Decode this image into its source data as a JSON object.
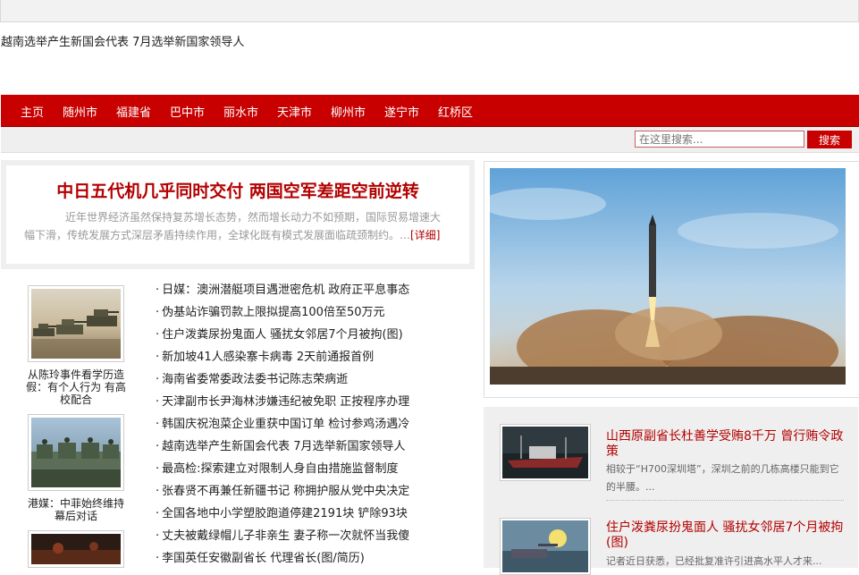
{
  "top_headline": "越南选举产生新国会代表  7月选举新国家领导人",
  "nav": {
    "items": [
      "主页",
      "随州市",
      "福建省",
      "巴中市",
      "丽水市",
      "天津市",
      "柳州市",
      "遂宁市",
      "红桥区"
    ]
  },
  "search": {
    "placeholder": "在这里搜索...",
    "button_label": "搜索"
  },
  "feature": {
    "title": "中日五代机几乎同时交付  两国空军差距空前逆转",
    "summary": "近年世界经济虽然保持复苏增长态势，然而增长动力不如预期，国际贸易增速大幅下滑，传统发展方式深层矛盾持续作用，全球化既有模式发展面临疏颈制约。…",
    "more_label": "[详细]"
  },
  "thumbs": [
    {
      "caption": "从陈玲事件看学历造假：有个人行为 有高校配合",
      "icon": "tanks-photo"
    },
    {
      "caption": "港媒：中菲始终维持幕后对话",
      "icon": "military-parade-photo"
    }
  ],
  "news_list": [
    "日媒：澳洲潜艇项目遇泄密危机 政府正平息事态",
    "伪基站诈骗罚款上限拟提高100倍至50万元",
    "住户泼粪尿扮鬼面人 骚扰女邻居7个月被拘(图)",
    "新加坡41人感染寨卡病毒 2天前通报首例",
    "海南省委常委政法委书记陈志荣病逝",
    "天津副市长尹海林涉嫌违纪被免职 正按程序办理",
    "韩国庆祝泡菜企业重获中国订单 检讨参鸡汤遇冷",
    "越南选举产生新国会代表 7月选举新国家领导人",
    "最高检:探索建立对限制人身自由措施监督制度",
    "张春贤不再兼任新疆书记 称拥护服从党中央决定",
    "全国各地中小学塑胶跑道停建2191块 铲除93块",
    "丈夫被戴绿帽儿子非亲生 妻子称一次就怀当我傻",
    "李国英任安徽副省长 代理省长(图/简历)"
  ],
  "side_news": [
    {
      "title": "山西原副省长杜善学受贿8千万 曾行贿令政策",
      "summary": "相较于“H700深圳塔”，深圳之前的几栋高楼只能到它的半腰。...",
      "icon": "ship-photo"
    },
    {
      "title": "住户泼粪尿扮鬼面人 骚扰女邻居7个月被拘(图)",
      "summary": "记者近日获悉，已经批复准许引进高水平人才来...",
      "icon": "naval-gun-photo"
    }
  ],
  "big_photo": {
    "icon": "missile-launch-photo"
  }
}
